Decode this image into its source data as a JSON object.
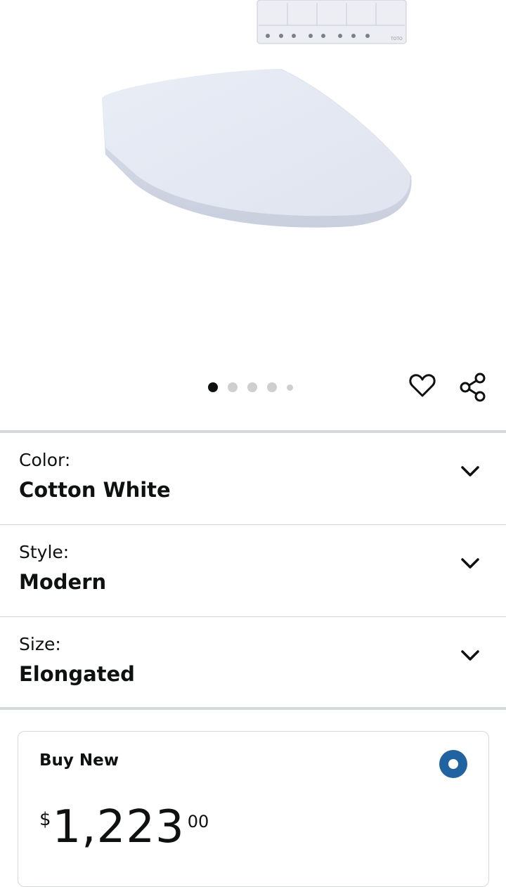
{
  "product_image": {
    "alt": "product-image",
    "carousel_count": 5,
    "active_index": 0
  },
  "remote_buttons_brand": "TOTO",
  "actions": {
    "wishlist_icon": "heart-icon",
    "share_icon": "share-icon"
  },
  "variations": [
    {
      "label": "Color:",
      "value": "Cotton White"
    },
    {
      "label": "Style:",
      "value": "Modern"
    },
    {
      "label": "Size:",
      "value": "Elongated"
    }
  ],
  "buy_box": {
    "title": "Buy New",
    "currency_symbol": "$",
    "price_whole": "1,223",
    "price_fraction": "00",
    "selected": true
  },
  "colors": {
    "accent_radio": "#2162a1",
    "divider": "#d5d9d9",
    "top_line": "#7fd6d2"
  }
}
